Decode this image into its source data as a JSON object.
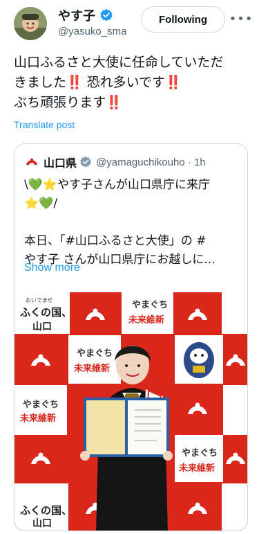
{
  "author": {
    "display_name": "やす子",
    "handle": "@yasuko_sma"
  },
  "follow_button": {
    "label": "Following"
  },
  "tweet": {
    "lines": [
      "山口ふるさと大使に任命していただ",
      "きました‼️ 恐れ多いです‼️",
      "ぶち頑張ります‼️"
    ],
    "translate_label": "Translate post"
  },
  "quoted": {
    "display_name": "山口県",
    "handle_time": "@yamaguchikouho · 1h",
    "lines": [
      "\\💚⭐やす子さんが山口県庁に来庁",
      "⭐💚/",
      "",
      "本日、「#山口ふるさと大使」の #",
      "やす子 さんが山口県庁にお越しに..."
    ],
    "show_more": "Show more"
  },
  "photo": {
    "banner_text_1": "ふくの国、",
    "banner_text_2": "山口",
    "banner_small": "おいでませ",
    "yamaguchi": "やまぐち",
    "mirai": "未来維新"
  },
  "colors": {
    "link": "#1d9bf0",
    "verified_gold": "#e2b719",
    "verified_blue": "#1d9bf0",
    "backdrop_red": "#d9271c"
  },
  "icons": [
    "verified-badge-icon",
    "more-options-icon",
    "verified-gray-icon"
  ]
}
